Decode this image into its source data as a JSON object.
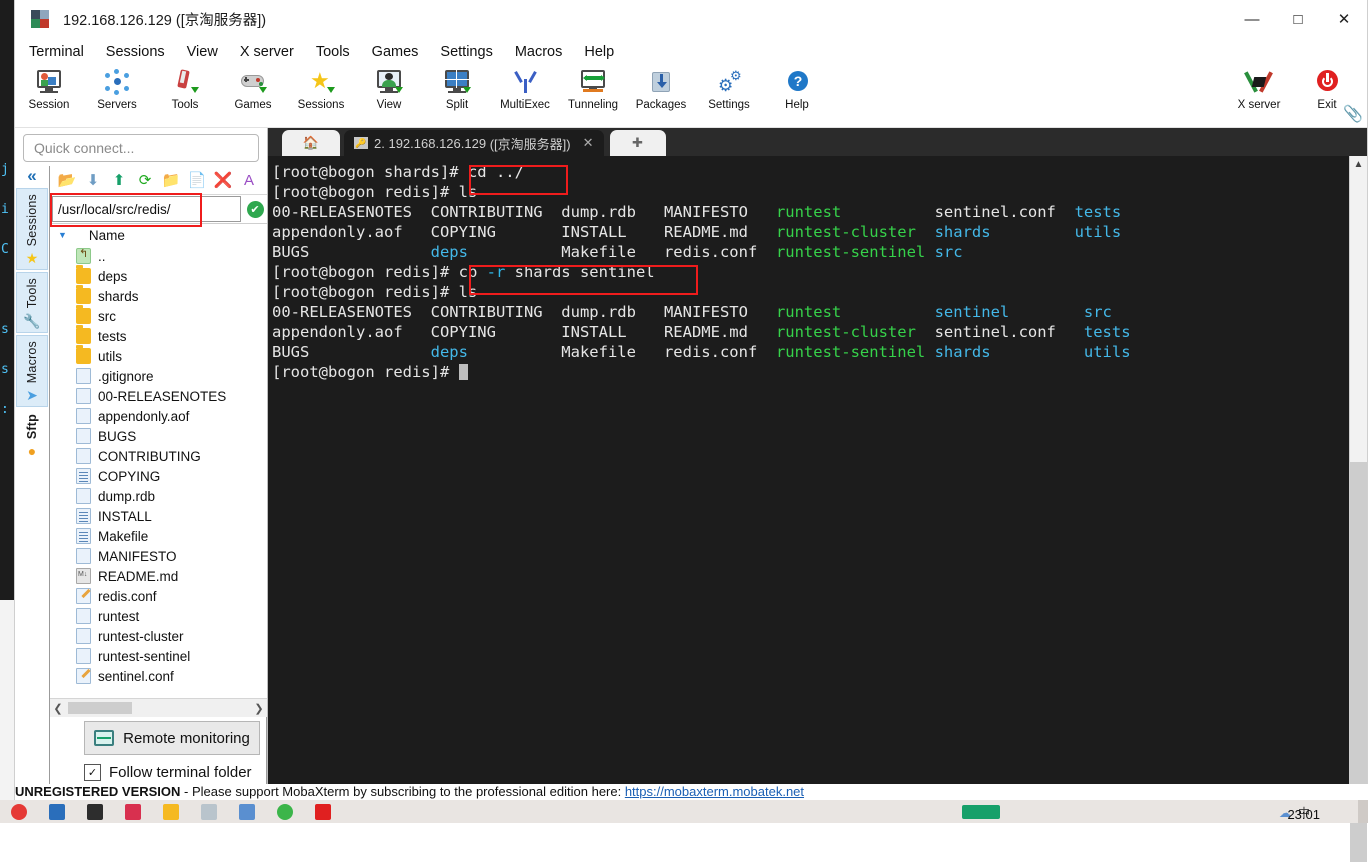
{
  "window": {
    "title": "192.168.126.129 ([京淘服务器])",
    "controls": {
      "minimize": "—",
      "maximize": "□",
      "close": "✕"
    }
  },
  "menubar": [
    "Terminal",
    "Sessions",
    "View",
    "X server",
    "Tools",
    "Games",
    "Settings",
    "Macros",
    "Help"
  ],
  "toolbar": {
    "items": [
      {
        "label": "Session",
        "icon": "session-icon"
      },
      {
        "label": "Servers",
        "icon": "servers-icon"
      },
      {
        "label": "Tools",
        "icon": "tools-icon"
      },
      {
        "label": "Games",
        "icon": "games-icon"
      },
      {
        "label": "Sessions",
        "icon": "star-icon"
      },
      {
        "label": "View",
        "icon": "view-icon"
      },
      {
        "label": "Split",
        "icon": "split-icon"
      },
      {
        "label": "MultiExec",
        "icon": "multiexec-icon"
      },
      {
        "label": "Tunneling",
        "icon": "tunneling-icon"
      },
      {
        "label": "Packages",
        "icon": "packages-icon"
      },
      {
        "label": "Settings",
        "icon": "settings-gear-icon"
      },
      {
        "label": "Help",
        "icon": "help-icon"
      }
    ],
    "right": [
      {
        "label": "X server",
        "icon": "x-server-icon"
      },
      {
        "label": "Exit",
        "icon": "power-icon"
      }
    ]
  },
  "sidebar": {
    "quick_connect_placeholder": "Quick connect...",
    "collapse_label": "«",
    "vtabs": [
      {
        "label": "Sessions",
        "icon": "★"
      },
      {
        "label": "Tools",
        "icon": "🔧"
      },
      {
        "label": "Macros",
        "icon": "➤"
      },
      {
        "label": "Sftp",
        "icon": "●"
      }
    ],
    "sftp_toolbar_icons": [
      "up-folder-icon",
      "download-icon",
      "upload-icon",
      "refresh-icon",
      "new-folder-icon",
      "new-file-icon",
      "delete-icon",
      "text-mode-icon"
    ],
    "path": "/usr/local/src/redis/",
    "path_ok": "✔",
    "column_header": "Name",
    "files": [
      {
        "name": "..",
        "type": "up"
      },
      {
        "name": "deps",
        "type": "folder"
      },
      {
        "name": "shards",
        "type": "folder"
      },
      {
        "name": "src",
        "type": "folder"
      },
      {
        "name": "tests",
        "type": "folder"
      },
      {
        "name": "utils",
        "type": "folder"
      },
      {
        "name": ".gitignore",
        "type": "file"
      },
      {
        "name": "00-RELEASENOTES",
        "type": "file"
      },
      {
        "name": "appendonly.aof",
        "type": "file"
      },
      {
        "name": "BUGS",
        "type": "file"
      },
      {
        "name": "CONTRIBUTING",
        "type": "file"
      },
      {
        "name": "COPYING",
        "type": "text"
      },
      {
        "name": "dump.rdb",
        "type": "file"
      },
      {
        "name": "INSTALL",
        "type": "text"
      },
      {
        "name": "Makefile",
        "type": "text"
      },
      {
        "name": "MANIFESTO",
        "type": "file"
      },
      {
        "name": "README.md",
        "type": "md"
      },
      {
        "name": "redis.conf",
        "type": "conf"
      },
      {
        "name": "runtest",
        "type": "file"
      },
      {
        "name": "runtest-cluster",
        "type": "file"
      },
      {
        "name": "runtest-sentinel",
        "type": "file"
      },
      {
        "name": "sentinel.conf",
        "type": "conf"
      }
    ],
    "remote_monitoring_label": "Remote monitoring",
    "follow_terminal_folder_label": "Follow terminal folder",
    "follow_terminal_folder_checked": "✓"
  },
  "tabs": {
    "home_icon": "🏠",
    "active": {
      "index": "2.",
      "ip": "192.168.126.129",
      "name": "([京淘服务器])",
      "close": "✕"
    },
    "new_tab": "✚"
  },
  "terminal": {
    "lines": [
      [
        {
          "t": "[root@bogon shards]# ",
          "c": "white"
        },
        {
          "t": "cd ../",
          "c": "white"
        }
      ],
      [
        {
          "t": "[root@bogon redis]# ",
          "c": "white"
        },
        {
          "t": "ls",
          "c": "white"
        }
      ],
      [
        {
          "t": "00-RELEASENOTES  ",
          "c": "white"
        },
        {
          "t": "CONTRIBUTING  ",
          "c": "white"
        },
        {
          "t": "dump.rdb   ",
          "c": "white"
        },
        {
          "t": "MANIFESTO   ",
          "c": "white"
        },
        {
          "t": "runtest          ",
          "c": "green"
        },
        {
          "t": "sentinel.conf  ",
          "c": "white"
        },
        {
          "t": "tests",
          "c": "blue"
        }
      ],
      [
        {
          "t": "appendonly.aof   ",
          "c": "white"
        },
        {
          "t": "COPYING       ",
          "c": "white"
        },
        {
          "t": "INSTALL    ",
          "c": "white"
        },
        {
          "t": "README.md   ",
          "c": "white"
        },
        {
          "t": "runtest-cluster  ",
          "c": "green"
        },
        {
          "t": "shards         ",
          "c": "blue"
        },
        {
          "t": "utils",
          "c": "blue"
        }
      ],
      [
        {
          "t": "BUGS             ",
          "c": "white"
        },
        {
          "t": "deps          ",
          "c": "blue"
        },
        {
          "t": "Makefile   ",
          "c": "white"
        },
        {
          "t": "redis.conf  ",
          "c": "white"
        },
        {
          "t": "runtest-sentinel ",
          "c": "green"
        },
        {
          "t": "src",
          "c": "blue"
        }
      ],
      [
        {
          "t": "[root@bogon redis]# ",
          "c": "white"
        },
        {
          "t": "cp ",
          "c": "white"
        },
        {
          "t": "-r ",
          "c": "cyan"
        },
        {
          "t": "shards sentinel",
          "c": "white"
        }
      ],
      [
        {
          "t": "[root@bogon redis]# ",
          "c": "white"
        },
        {
          "t": "ls",
          "c": "white"
        }
      ],
      [
        {
          "t": "00-RELEASENOTES  ",
          "c": "white"
        },
        {
          "t": "CONTRIBUTING  ",
          "c": "white"
        },
        {
          "t": "dump.rdb   ",
          "c": "white"
        },
        {
          "t": "MANIFESTO   ",
          "c": "white"
        },
        {
          "t": "runtest          ",
          "c": "green"
        },
        {
          "t": "sentinel        ",
          "c": "blue"
        },
        {
          "t": "src",
          "c": "blue"
        }
      ],
      [
        {
          "t": "appendonly.aof   ",
          "c": "white"
        },
        {
          "t": "COPYING       ",
          "c": "white"
        },
        {
          "t": "INSTALL    ",
          "c": "white"
        },
        {
          "t": "README.md   ",
          "c": "white"
        },
        {
          "t": "runtest-cluster  ",
          "c": "green"
        },
        {
          "t": "sentinel.conf   ",
          "c": "white"
        },
        {
          "t": "tests",
          "c": "blue"
        }
      ],
      [
        {
          "t": "BUGS             ",
          "c": "white"
        },
        {
          "t": "deps          ",
          "c": "blue"
        },
        {
          "t": "Makefile   ",
          "c": "white"
        },
        {
          "t": "redis.conf  ",
          "c": "white"
        },
        {
          "t": "runtest-sentinel ",
          "c": "green"
        },
        {
          "t": "shards          ",
          "c": "blue"
        },
        {
          "t": "utils",
          "c": "blue"
        }
      ],
      [
        {
          "t": "[root@bogon redis]# ",
          "c": "white"
        }
      ]
    ],
    "highlights": [
      {
        "name": "cd-command-highlight",
        "text": "cd ../"
      },
      {
        "name": "cp-command-highlight",
        "text": "cp -r shards sentinel"
      }
    ],
    "colors": {
      "background": "#1c1c1c",
      "white": "#e6e6e6",
      "green": "#36d14a",
      "blue": "#44b8e8",
      "cyan": "#2fb7e8",
      "highlight": "#ef1c1c"
    }
  },
  "footer": {
    "unregistered_bold": "UNREGISTERED VERSION",
    "unregistered_text": " - Please support MobaXterm by subscribing to the professional edition here: ",
    "unregistered_link": "https://mobaxterm.mobatek.net"
  },
  "taskbar": {
    "clock": "23:01"
  }
}
